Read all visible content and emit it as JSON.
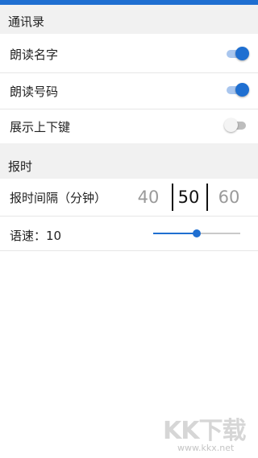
{
  "colors": {
    "accent": "#1f6fd1",
    "section_bg": "#f1f1f1",
    "toggle_off": "#bdbdbd"
  },
  "contacts": {
    "title": "通讯录",
    "items": [
      {
        "label": "朗读名字",
        "toggle": "on"
      },
      {
        "label": "朗读号码",
        "toggle": "on"
      },
      {
        "label": "展示上下键",
        "toggle": "off"
      }
    ]
  },
  "time_report": {
    "title": "报时",
    "interval": {
      "label": "报时间隔（分钟）",
      "prev": "40",
      "selected": "50",
      "next": "60"
    },
    "speed": {
      "label": "语速：10",
      "value_fraction": 0.5
    }
  },
  "watermark": {
    "logo_text": "KK下载",
    "url": "www.kkx.net"
  }
}
